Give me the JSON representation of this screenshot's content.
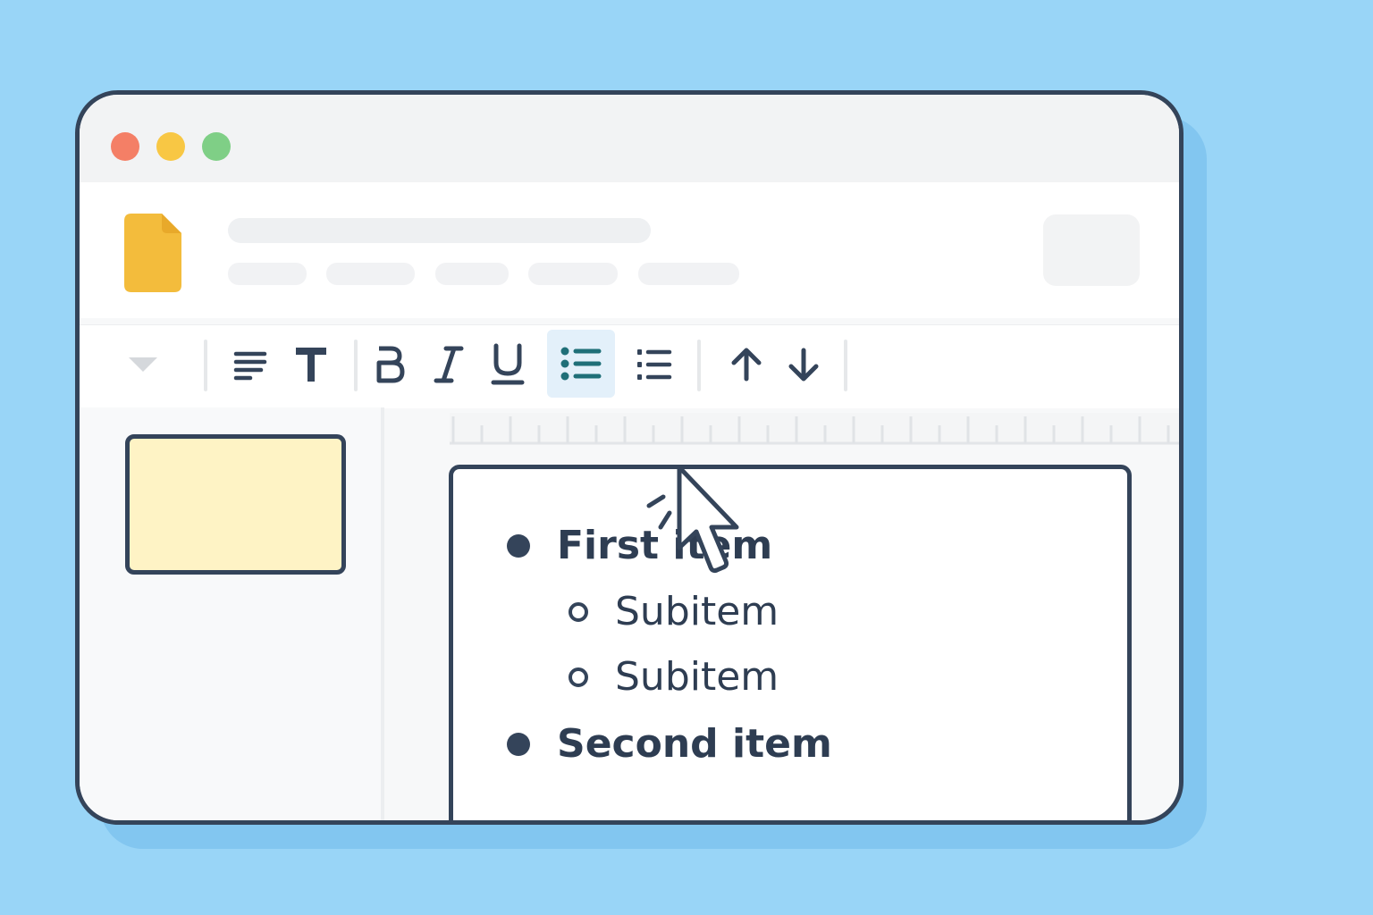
{
  "colors": {
    "background": "#99d5f7",
    "window_border": "#34445a",
    "doc_icon": "#f3bc3c",
    "active_button_bg": "#e3f0fa",
    "active_button_icon": "#1f6f78",
    "thumbnail_fill": "#fef3c5"
  },
  "window_controls": [
    "close",
    "minimize",
    "maximize"
  ],
  "toolbar": {
    "buttons": [
      {
        "name": "dropdown",
        "icon": "chevron-down-icon"
      },
      {
        "name": "align-left",
        "icon": "align-left-icon"
      },
      {
        "name": "text-style",
        "icon": "text-style-icon"
      },
      {
        "name": "bold",
        "icon": "bold-icon"
      },
      {
        "name": "italic",
        "icon": "italic-icon"
      },
      {
        "name": "underline",
        "icon": "underline-icon"
      },
      {
        "name": "bulleted-list",
        "icon": "bulleted-list-icon",
        "active": true
      },
      {
        "name": "numbered-list",
        "icon": "numbered-list-icon"
      },
      {
        "name": "move-up",
        "icon": "arrow-up-icon"
      },
      {
        "name": "move-down",
        "icon": "arrow-down-icon"
      }
    ]
  },
  "document": {
    "list": [
      {
        "text": "First item",
        "level": 1
      },
      {
        "text": "Subitem",
        "level": 2
      },
      {
        "text": "Subitem",
        "level": 2
      },
      {
        "text": "Second item",
        "level": 1
      }
    ]
  }
}
